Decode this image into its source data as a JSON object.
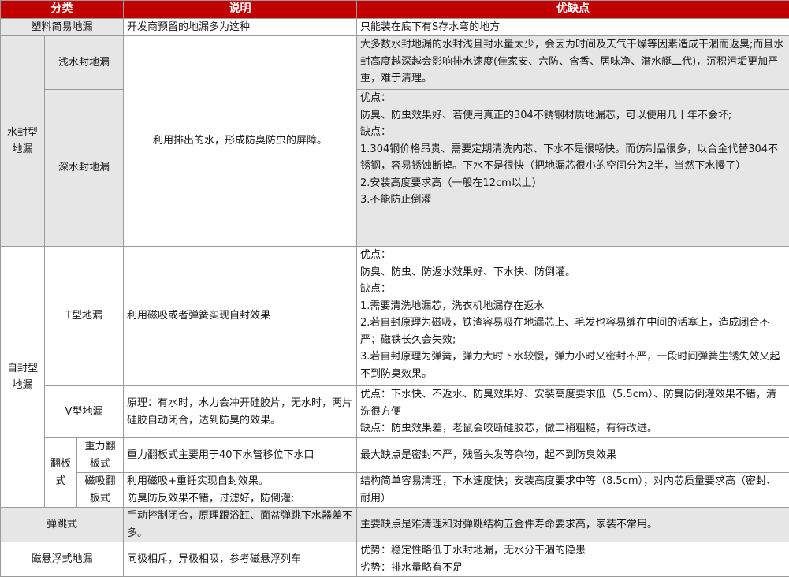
{
  "header": {
    "category": "分类",
    "explanation": "说明",
    "pros_cons": "优缺点"
  },
  "plastic": {
    "name": "塑料简易地漏",
    "explanation": "开发商预留的地漏多为这种",
    "pros_cons": "只能装在底下有S存水弯的地方"
  },
  "water_seal": {
    "group": "水封型地漏",
    "explanation": "利用排出的水，形成防臭防虫的屏障。",
    "shallow": {
      "name": "浅水封地漏",
      "pros_cons": "大多数水封地漏的水封浅且封水量太少，会因为时间及天气干燥等因素造成干涸而返臭;而且水封高度越深越会影响排水速度(佳家安、六防、含香、居味净、潜水艇二代)，沉积污垢更加严重，难于清理。"
    },
    "deep": {
      "name": "深水封地漏",
      "lines": [
        "优点：",
        "防臭、防虫效果好、若使用真正的304不锈钢材质地漏芯，可以使用几十年不会坏;",
        "缺点：",
        "1.304钢价格昂贵、需要定期清洗内芯、下水不是很畅快。而仿制品很多，以合金代替304不锈钢，容易锈蚀断掉。下水不是很快（把地漏芯很小的空间分为2半，当然下水慢了）",
        "2.安装高度要求高（一般在12cm以上）",
        "3.不能防止倒灌"
      ]
    }
  },
  "self_seal": {
    "group": "自封型地漏",
    "t_type": {
      "name": "T型地漏",
      "explanation": "利用磁吸或者弹簧实现自封效果",
      "lines": [
        "优点：",
        "防臭、防虫、防返水效果好、下水快、防倒灌。",
        "缺点：",
        "1.需要清洗地漏芯，洗衣机地漏存在返水",
        "2.若自封原理为磁吸，铁渣容易吸在地漏芯上、毛发也容易缠在中间的活塞上，造成闭合不严；磁铁长久会失效;",
        "3.若自封原理为弹簧，弹力大时下水较慢，弹力小时又密封不严，一段时间弹簧生锈失效又起不到防臭效果。"
      ]
    },
    "v_type": {
      "name": "V型地漏",
      "explanation": "原理：有水时，水力会冲开硅胶片，无水时，两片硅胶自动闭合，达到防臭的效果。",
      "lines": [
        "优点：下水快、不返水、防臭效果好、安装高度要求低（5.5cm）、防臭防倒灌效果不错，清洗很方便",
        "缺点：防虫效果差，老鼠会咬断硅胶芯，做工稍粗糙，有待改进。"
      ]
    },
    "flap": {
      "group": "翻板式",
      "gravity": {
        "name": "重力翻板式",
        "explanation": "重力翻板式主要用于40下水管移位下水口",
        "pros_cons": "最大缺点是密封不严，残留头发等杂物，起不到防臭效果"
      },
      "magnetic": {
        "name": "磁吸翻板式",
        "explanation_lines": [
          "利用磁吸+重锤实现自封效果。",
          "防臭防反效果不错，过滤好，防倒灌;"
        ],
        "pros_cons": "结构简单容易清理，下水速度快；安装高度要求中等（8.5cm）；对内芯质量要求高（密封、耐用）"
      }
    }
  },
  "bounce": {
    "name": "弹跳式",
    "explanation": "手动控制闭合，原理跟浴缸、面盆弹跳下水器差不多。",
    "pros_cons": "主要缺点是难清理和对弹跳结构五金件寿命要求高，家装不常用。"
  },
  "maglev": {
    "name": "磁悬浮式地漏",
    "explanation": "同极相斥，异极相吸，参考磁悬浮列车",
    "lines": [
      "优势：稳定性略低于水封地漏，无水分干涸的隐患",
      "劣势：排水量略有不足"
    ]
  }
}
